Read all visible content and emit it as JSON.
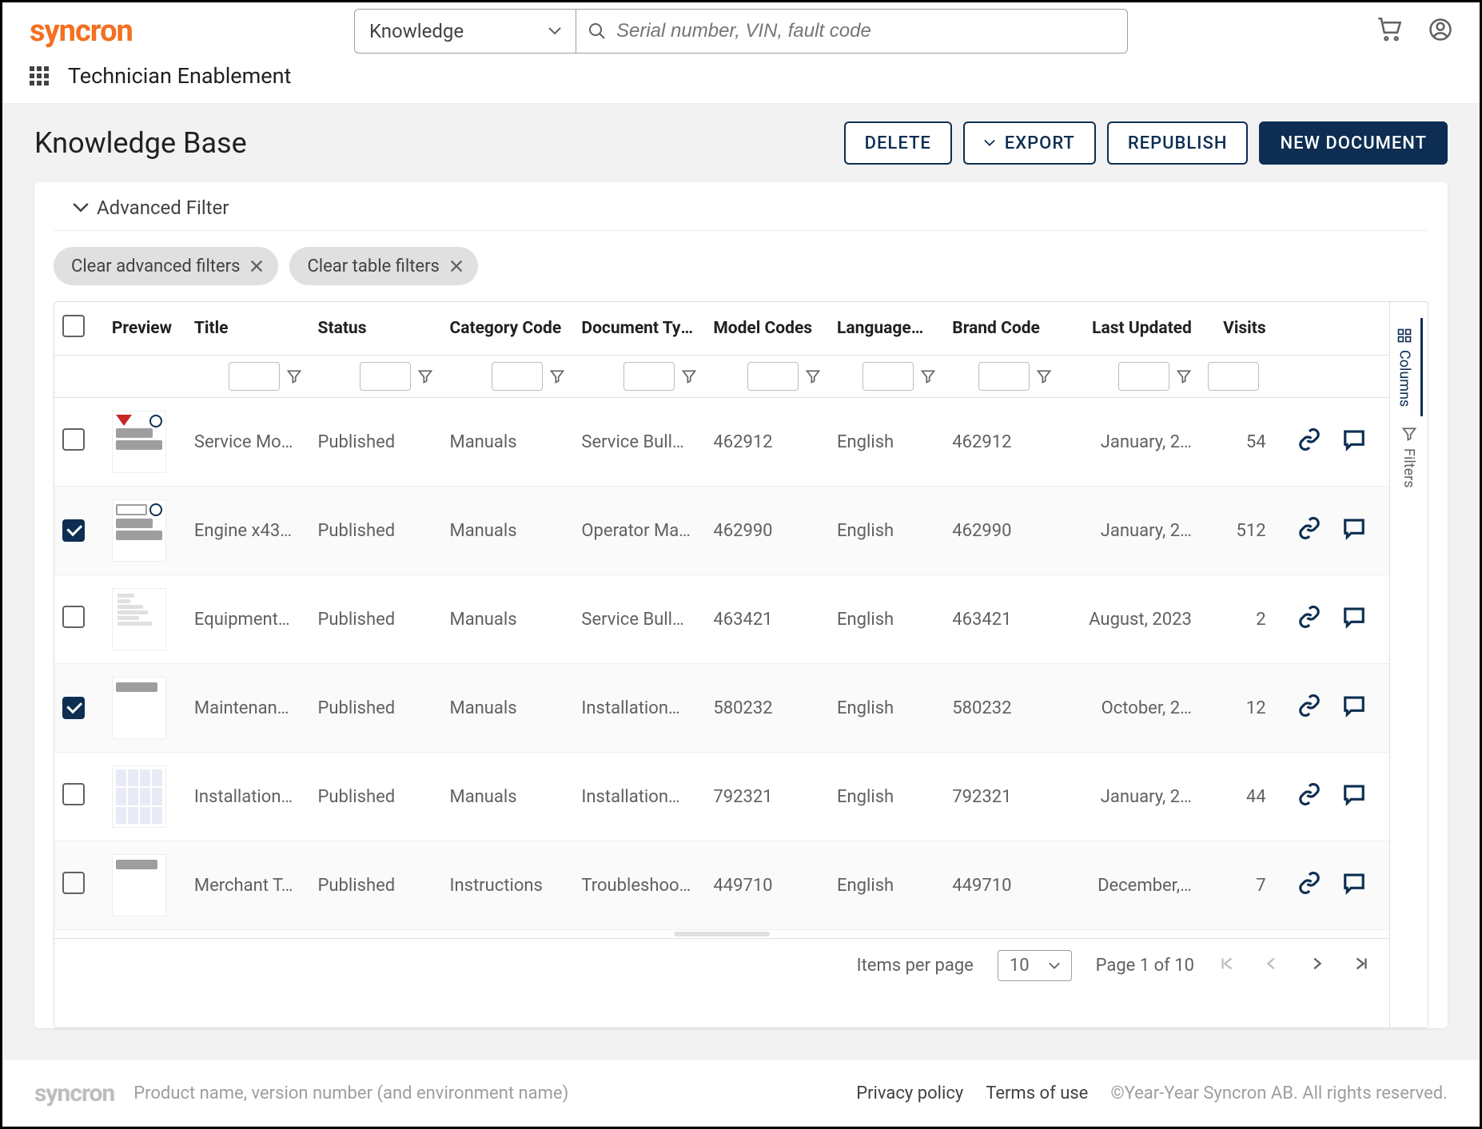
{
  "brand": "syncron",
  "search": {
    "dropdown_label": "Knowledge",
    "placeholder": "Serial number, VIN, fault code"
  },
  "nav_title": "Technician Enablement",
  "page_title": "Knowledge Base",
  "buttons": {
    "delete": "DELETE",
    "export": "EXPORT",
    "republish": "REPUBLISH",
    "new_document": "NEW DOCUMENT"
  },
  "advanced_filter_label": "Advanced Filter",
  "chips": {
    "clear_advanced": "Clear advanced filters",
    "clear_table": "Clear table filters"
  },
  "columns": [
    "Preview",
    "Title",
    "Status",
    "Category Code",
    "Document Type",
    "Model Codes",
    "Language…",
    "Brand Code",
    "Last Updated",
    "Visits"
  ],
  "rows": [
    {
      "checked": false,
      "thumb": "v1",
      "title": "Service Mo…",
      "status": "Published",
      "category": "Manuals",
      "doc_type": "Service Bull…",
      "model": "462912",
      "lang": "English",
      "brand": "462912",
      "updated": "January, 2…",
      "visits": "54"
    },
    {
      "checked": true,
      "thumb": "v2",
      "title": "Engine x43…",
      "status": "Published",
      "category": "Manuals",
      "doc_type": "Operator Ma…",
      "model": "462990",
      "lang": "English",
      "brand": "462990",
      "updated": "January, 2…",
      "visits": "512"
    },
    {
      "checked": false,
      "thumb": "v3",
      "title": "Equipment…",
      "status": "Published",
      "category": "Manuals",
      "doc_type": "Service Bull…",
      "model": "463421",
      "lang": "English",
      "brand": "463421",
      "updated": "August, 2023",
      "visits": "2"
    },
    {
      "checked": true,
      "thumb": "v4",
      "title": "Maintenan…",
      "status": "Published",
      "category": "Manuals",
      "doc_type": "Installation…",
      "model": "580232",
      "lang": "English",
      "brand": "580232",
      "updated": "October, 2…",
      "visits": "12"
    },
    {
      "checked": false,
      "thumb": "v5",
      "title": "Installation…",
      "status": "Published",
      "category": "Manuals",
      "doc_type": "Installation…",
      "model": "792321",
      "lang": "English",
      "brand": "792321",
      "updated": "January, 2…",
      "visits": "44"
    },
    {
      "checked": false,
      "thumb": "v6",
      "title": "Merchant T…",
      "status": "Published",
      "category": "Instructions",
      "doc_type": "Troubleshoo…",
      "model": "449710",
      "lang": "English",
      "brand": "449710",
      "updated": "December,…",
      "visits": "7"
    }
  ],
  "side_rail": {
    "columns": "Columns",
    "filters": "Filters"
  },
  "pagination": {
    "items_per_page_label": "Items per page",
    "items_per_page_value": "10",
    "page_info": "Page 1 of 10"
  },
  "footer": {
    "logo": "syncron",
    "product_line": "Product name, version number (and environment name)",
    "privacy": "Privacy policy",
    "terms": "Terms of use",
    "copyright": "©Year-Year Syncron AB. All rights reserved."
  }
}
